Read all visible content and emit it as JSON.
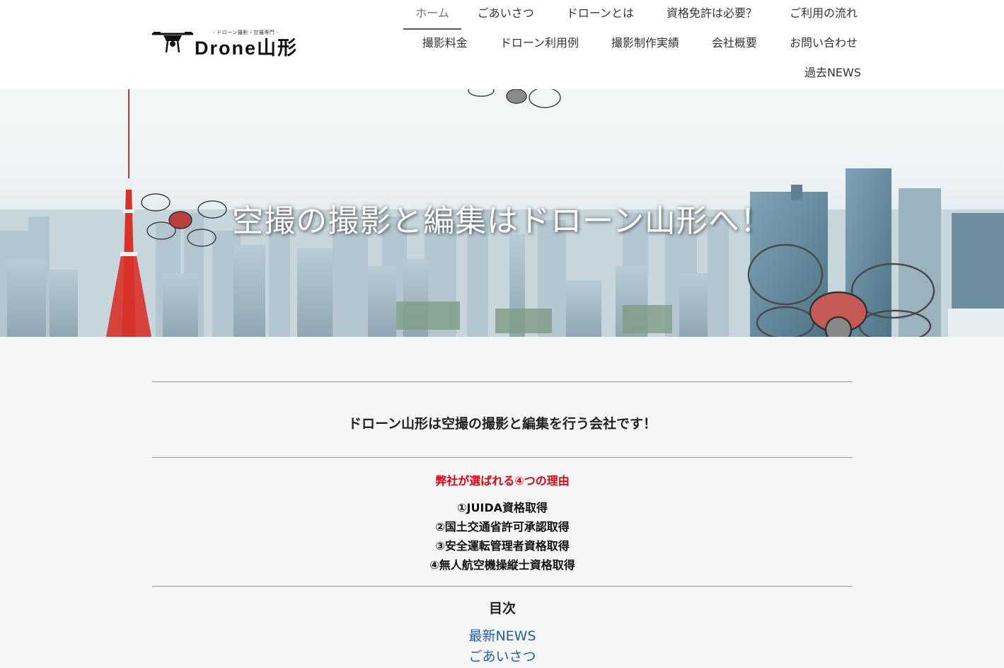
{
  "header": {
    "logo_tagline": "- ドローン撮影・空撮専門 -",
    "logo_text": "Drone山形",
    "nav_row1": [
      "ホーム",
      "ごあいさつ",
      "ドローンとは",
      "資格免許は必要？",
      "ご利用の流れ"
    ],
    "nav_row2": [
      "撮影料金",
      "ドローン利用例",
      "撮影制作実績",
      "会社概要",
      "お問い合わせ"
    ],
    "nav_row3": [
      "過去NEWS"
    ]
  },
  "hero": {
    "title": "空撮の撮影と編集はドローン山形へ！"
  },
  "main": {
    "lead": "ドローン山形は空撮の撮影と編集を行う会社です！",
    "reasons_title": "弊社が選ばれる④つの理由",
    "reasons": [
      "①JUIDA資格取得",
      "②国土交通省許可承認取得",
      "③安全運転管理者資格取得",
      "④無人航空機操縦士資格取得"
    ],
    "toc_title": "目次",
    "toc_links": [
      "最新NEWS",
      "ごあいさつ"
    ]
  },
  "colors": {
    "accent_red": "#e60012",
    "link_blue": "#1f5fa8",
    "page_bg": "#f5f7f6"
  }
}
